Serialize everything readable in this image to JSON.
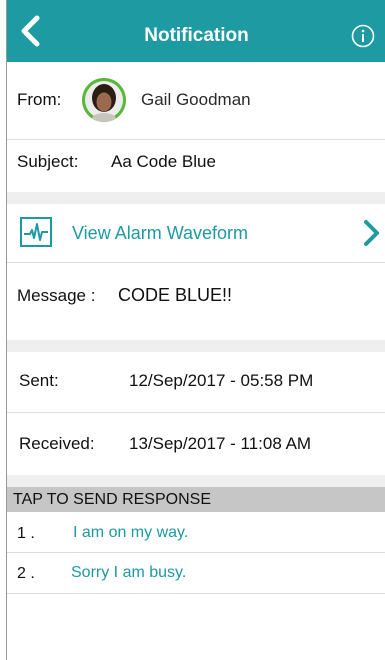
{
  "header": {
    "title": "Notification",
    "back_icon": "chevron-left-icon",
    "info_icon": "info-icon",
    "bg_color": "#1d9aa2"
  },
  "from": {
    "label": "From:",
    "name": "Gail Goodman",
    "avatar_ring_color": "#59b73a"
  },
  "subject": {
    "label": "Subject:",
    "value": "Aa Code Blue"
  },
  "waveform": {
    "icon": "waveform-icon",
    "label": "View Alarm Waveform",
    "chevron": "chevron-right-icon"
  },
  "message": {
    "label": "Message :",
    "value": "CODE BLUE!!"
  },
  "sent": {
    "label": "Sent:",
    "value": "12/Sep/2017 - 05:58 PM"
  },
  "received": {
    "label": "Received:",
    "value": "13/Sep/2017 - 11:08 AM"
  },
  "responses": {
    "header": "TAP TO SEND RESPONSE",
    "items": [
      {
        "number": "1 .",
        "text": "I am on my way."
      },
      {
        "number": "2 .",
        "text": "Sorry I am busy."
      }
    ]
  },
  "accent_color": "#1d9aa2"
}
